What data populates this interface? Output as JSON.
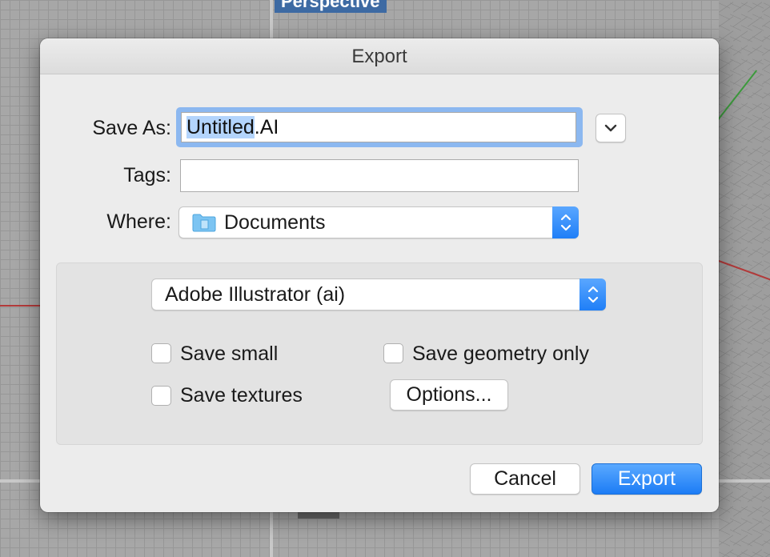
{
  "viewport": {
    "label": "Perspective"
  },
  "dialog": {
    "title": "Export",
    "save_as": {
      "label": "Save As:",
      "filename_selected": "Untitled",
      "filename_extension": ".AI"
    },
    "tags": {
      "label": "Tags:",
      "value": ""
    },
    "where": {
      "label": "Where:",
      "value": "Documents",
      "icon": "folder-icon"
    },
    "format": {
      "selected": "Adobe Illustrator (ai)"
    },
    "options": {
      "save_small": {
        "label": "Save small",
        "checked": false
      },
      "save_textures": {
        "label": "Save textures",
        "checked": false
      },
      "save_geometry_only": {
        "label": "Save geometry only",
        "checked": false
      },
      "options_button": "Options..."
    },
    "buttons": {
      "cancel": "Cancel",
      "export": "Export"
    },
    "colors": {
      "accent": "#1f7ff7",
      "selection": "#b3d4fc"
    }
  }
}
